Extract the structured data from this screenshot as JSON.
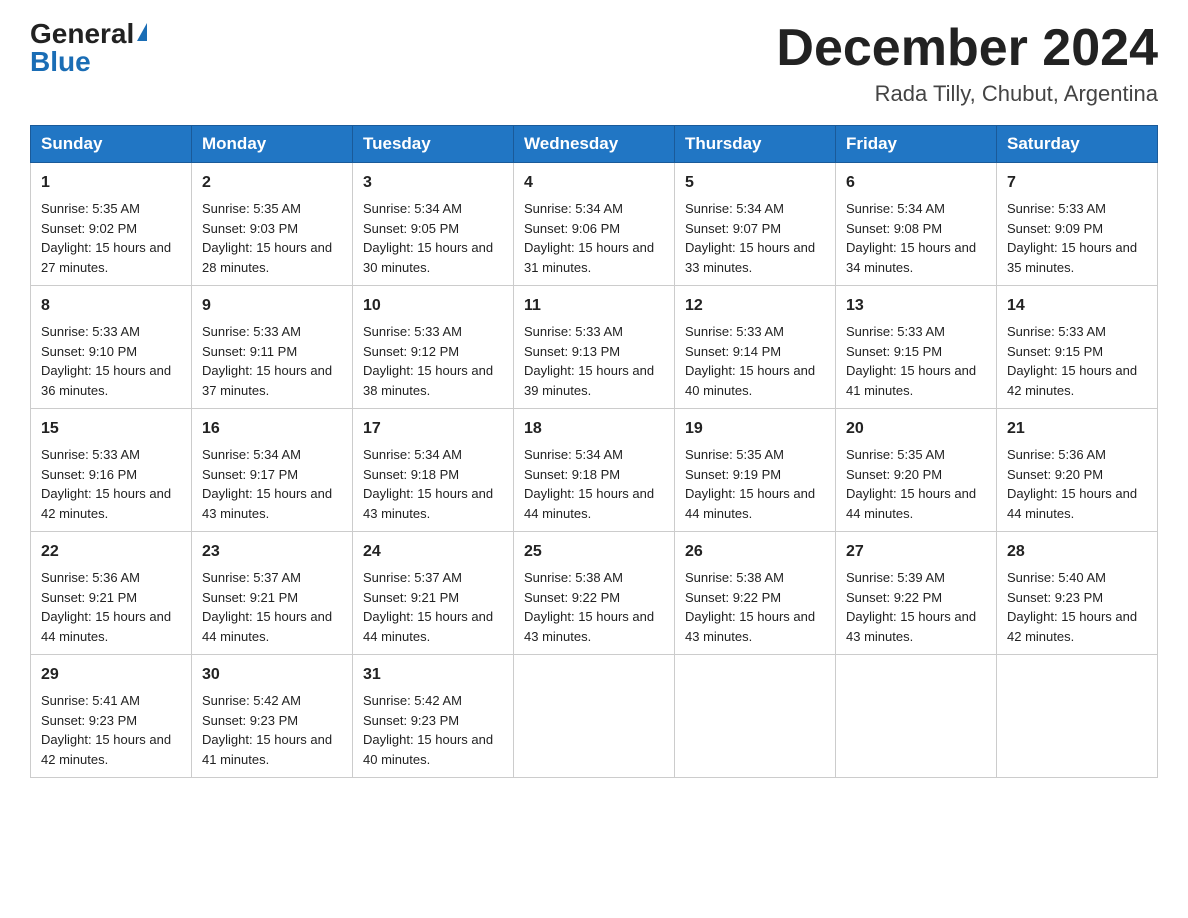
{
  "header": {
    "logo_general": "General",
    "logo_blue": "Blue",
    "month_title": "December 2024",
    "location": "Rada Tilly, Chubut, Argentina"
  },
  "days_of_week": [
    "Sunday",
    "Monday",
    "Tuesday",
    "Wednesday",
    "Thursday",
    "Friday",
    "Saturday"
  ],
  "weeks": [
    [
      {
        "day": "1",
        "sunrise": "5:35 AM",
        "sunset": "9:02 PM",
        "daylight": "15 hours and 27 minutes."
      },
      {
        "day": "2",
        "sunrise": "5:35 AM",
        "sunset": "9:03 PM",
        "daylight": "15 hours and 28 minutes."
      },
      {
        "day": "3",
        "sunrise": "5:34 AM",
        "sunset": "9:05 PM",
        "daylight": "15 hours and 30 minutes."
      },
      {
        "day": "4",
        "sunrise": "5:34 AM",
        "sunset": "9:06 PM",
        "daylight": "15 hours and 31 minutes."
      },
      {
        "day": "5",
        "sunrise": "5:34 AM",
        "sunset": "9:07 PM",
        "daylight": "15 hours and 33 minutes."
      },
      {
        "day": "6",
        "sunrise": "5:34 AM",
        "sunset": "9:08 PM",
        "daylight": "15 hours and 34 minutes."
      },
      {
        "day": "7",
        "sunrise": "5:33 AM",
        "sunset": "9:09 PM",
        "daylight": "15 hours and 35 minutes."
      }
    ],
    [
      {
        "day": "8",
        "sunrise": "5:33 AM",
        "sunset": "9:10 PM",
        "daylight": "15 hours and 36 minutes."
      },
      {
        "day": "9",
        "sunrise": "5:33 AM",
        "sunset": "9:11 PM",
        "daylight": "15 hours and 37 minutes."
      },
      {
        "day": "10",
        "sunrise": "5:33 AM",
        "sunset": "9:12 PM",
        "daylight": "15 hours and 38 minutes."
      },
      {
        "day": "11",
        "sunrise": "5:33 AM",
        "sunset": "9:13 PM",
        "daylight": "15 hours and 39 minutes."
      },
      {
        "day": "12",
        "sunrise": "5:33 AM",
        "sunset": "9:14 PM",
        "daylight": "15 hours and 40 minutes."
      },
      {
        "day": "13",
        "sunrise": "5:33 AM",
        "sunset": "9:15 PM",
        "daylight": "15 hours and 41 minutes."
      },
      {
        "day": "14",
        "sunrise": "5:33 AM",
        "sunset": "9:15 PM",
        "daylight": "15 hours and 42 minutes."
      }
    ],
    [
      {
        "day": "15",
        "sunrise": "5:33 AM",
        "sunset": "9:16 PM",
        "daylight": "15 hours and 42 minutes."
      },
      {
        "day": "16",
        "sunrise": "5:34 AM",
        "sunset": "9:17 PM",
        "daylight": "15 hours and 43 minutes."
      },
      {
        "day": "17",
        "sunrise": "5:34 AM",
        "sunset": "9:18 PM",
        "daylight": "15 hours and 43 minutes."
      },
      {
        "day": "18",
        "sunrise": "5:34 AM",
        "sunset": "9:18 PM",
        "daylight": "15 hours and 44 minutes."
      },
      {
        "day": "19",
        "sunrise": "5:35 AM",
        "sunset": "9:19 PM",
        "daylight": "15 hours and 44 minutes."
      },
      {
        "day": "20",
        "sunrise": "5:35 AM",
        "sunset": "9:20 PM",
        "daylight": "15 hours and 44 minutes."
      },
      {
        "day": "21",
        "sunrise": "5:36 AM",
        "sunset": "9:20 PM",
        "daylight": "15 hours and 44 minutes."
      }
    ],
    [
      {
        "day": "22",
        "sunrise": "5:36 AM",
        "sunset": "9:21 PM",
        "daylight": "15 hours and 44 minutes."
      },
      {
        "day": "23",
        "sunrise": "5:37 AM",
        "sunset": "9:21 PM",
        "daylight": "15 hours and 44 minutes."
      },
      {
        "day": "24",
        "sunrise": "5:37 AM",
        "sunset": "9:21 PM",
        "daylight": "15 hours and 44 minutes."
      },
      {
        "day": "25",
        "sunrise": "5:38 AM",
        "sunset": "9:22 PM",
        "daylight": "15 hours and 43 minutes."
      },
      {
        "day": "26",
        "sunrise": "5:38 AM",
        "sunset": "9:22 PM",
        "daylight": "15 hours and 43 minutes."
      },
      {
        "day": "27",
        "sunrise": "5:39 AM",
        "sunset": "9:22 PM",
        "daylight": "15 hours and 43 minutes."
      },
      {
        "day": "28",
        "sunrise": "5:40 AM",
        "sunset": "9:23 PM",
        "daylight": "15 hours and 42 minutes."
      }
    ],
    [
      {
        "day": "29",
        "sunrise": "5:41 AM",
        "sunset": "9:23 PM",
        "daylight": "15 hours and 42 minutes."
      },
      {
        "day": "30",
        "sunrise": "5:42 AM",
        "sunset": "9:23 PM",
        "daylight": "15 hours and 41 minutes."
      },
      {
        "day": "31",
        "sunrise": "5:42 AM",
        "sunset": "9:23 PM",
        "daylight": "15 hours and 40 minutes."
      },
      null,
      null,
      null,
      null
    ]
  ]
}
